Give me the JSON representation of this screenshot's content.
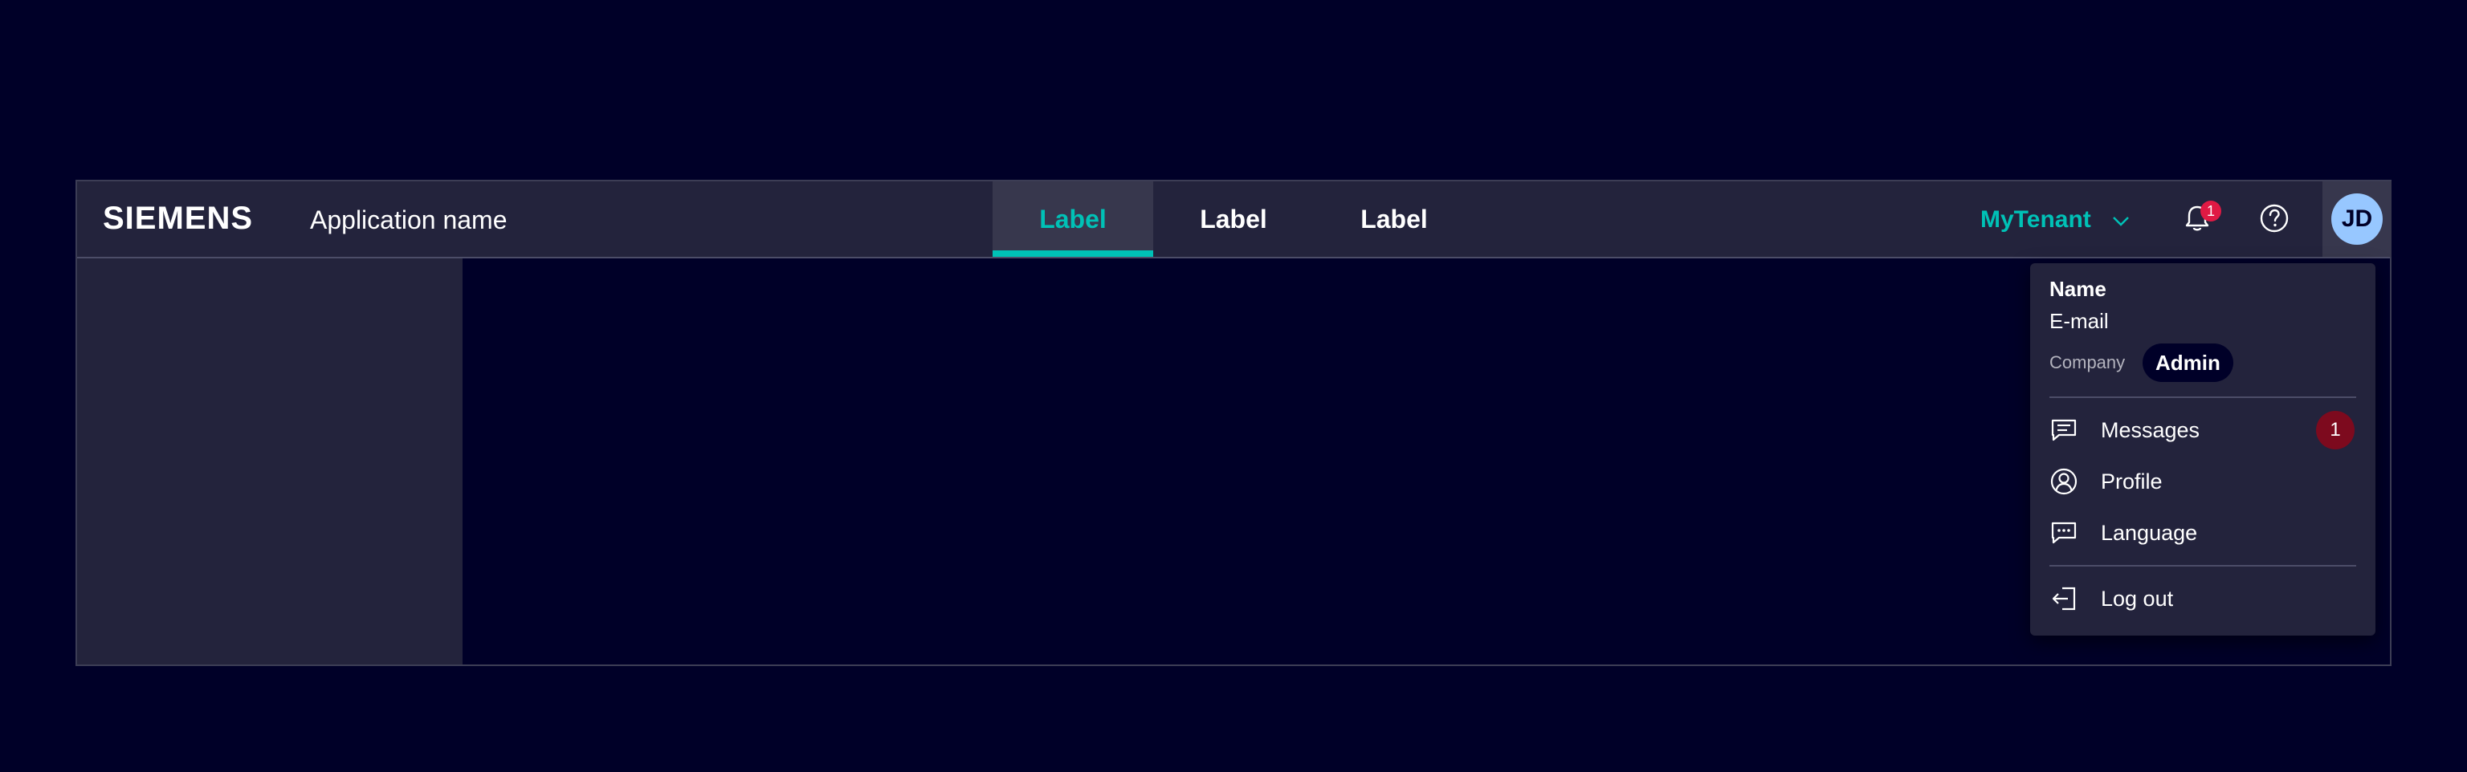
{
  "header": {
    "brand": "SIEMENS",
    "app_name": "Application name",
    "tabs": [
      {
        "label": "Label",
        "active": true
      },
      {
        "label": "Label",
        "active": false
      },
      {
        "label": "Label",
        "active": false
      }
    ],
    "tenant": "MyTenant",
    "notification_count": "1",
    "avatar_initials": "JD"
  },
  "user_menu": {
    "name": "Name",
    "email": "E-mail",
    "company": "Company",
    "role": "Admin",
    "items": [
      {
        "label": "Messages",
        "icon": "chat-icon",
        "badge": "1"
      },
      {
        "label": "Profile",
        "icon": "user-circle-icon"
      },
      {
        "label": "Language",
        "icon": "speech-bubble-dots-icon"
      }
    ],
    "logout_label": "Log out"
  },
  "colors": {
    "background": "#000028",
    "surface": "#23233c",
    "accent": "#00c1b6",
    "badge": "#e01a44",
    "avatar": "#97c7ff"
  }
}
